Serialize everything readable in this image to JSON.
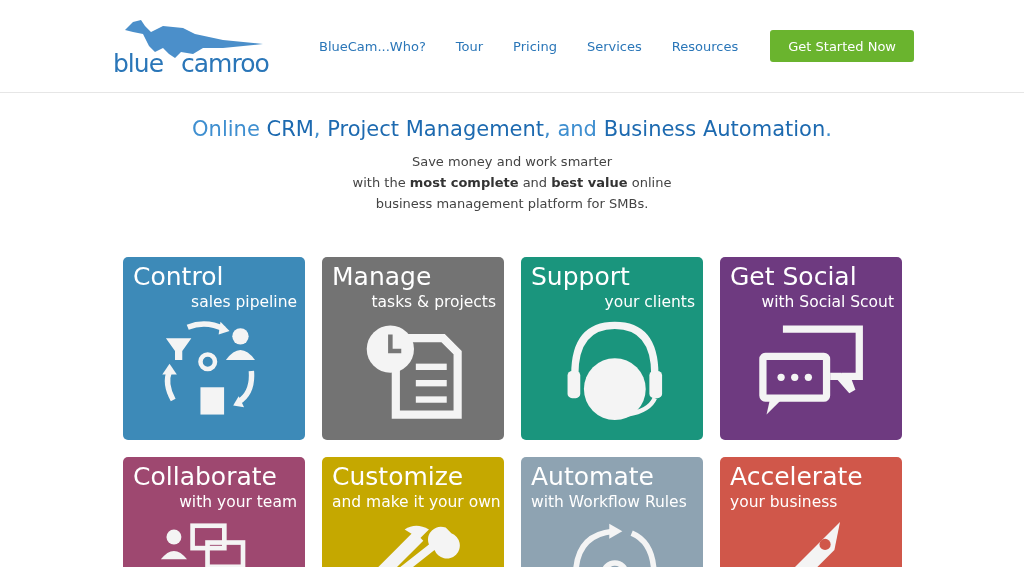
{
  "header": {
    "logo": {
      "word_1": "blue",
      "word_2": "camroo"
    },
    "nav": [
      "BlueCam...Who?",
      "Tour",
      "Pricing",
      "Services",
      "Resources"
    ],
    "cta_button": "Get Started Now"
  },
  "hero": {
    "title": [
      {
        "text": "Online ",
        "strong": false
      },
      {
        "text": "CRM",
        "strong": true
      },
      {
        "text": ", ",
        "strong": false
      },
      {
        "text": "Project Management",
        "strong": true
      },
      {
        "text": ", and ",
        "strong": false
      },
      {
        "text": "Business Automation",
        "strong": true
      },
      {
        "text": ".",
        "strong": false
      }
    ],
    "subtitle_lines": [
      "Save money and work smarter",
      "with the **most complete** and **best value** online",
      "business management platform for SMBs."
    ]
  },
  "tiles": [
    {
      "title": "Control",
      "subtitle": "sales pipeline",
      "color": "#3d8ab8",
      "kind": "pipeline"
    },
    {
      "title": "Manage",
      "subtitle": "tasks & projects",
      "color": "#737373",
      "kind": "document"
    },
    {
      "title": "Support",
      "subtitle": "your clients",
      "color": "#1a957d",
      "kind": "headset"
    },
    {
      "title": "Get Social",
      "subtitle": "with Social Scout",
      "color": "#6e3a80",
      "kind": "chat"
    },
    {
      "title": "Collaborate",
      "subtitle": "with your team",
      "color": "#9e4870",
      "kind": "team"
    },
    {
      "title": "Customize",
      "subtitle": "and make it your own",
      "color": "#c5a800",
      "kind": "tools"
    },
    {
      "title": "Automate",
      "subtitle": "with Workflow Rules",
      "color": "#8ea3b2",
      "kind": "cycle"
    },
    {
      "title": "Accelerate",
      "subtitle": "your business",
      "color": "#d0574a",
      "kind": "rocket"
    }
  ]
}
